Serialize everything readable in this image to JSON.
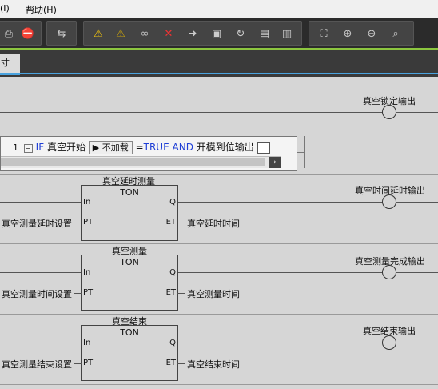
{
  "menubar": {
    "items": [
      "(I)",
      "帮助(H)"
    ]
  },
  "toolbar": {
    "icons": [
      "print-icon",
      "debug-icon",
      "transfer-icon",
      "warning-icon",
      "warning-off-icon",
      "watch-icon",
      "breakpoint-icon",
      "step-icon",
      "step-over-icon",
      "reset-icon",
      "force-on-icon",
      "force-off-icon",
      "fit-icon",
      "zoom-in-icon",
      "zoom-out-icon",
      "zoom-reset-icon"
    ]
  },
  "tab": {
    "label": "寸"
  },
  "rungs": {
    "r1": {
      "coil": "真空锁定输出"
    },
    "r2": {
      "st_line_no": "1",
      "st_if": "IF",
      "st_cond": "真空开始",
      "st_dropdown": "不加载",
      "st_eq": "=",
      "st_true": "TRUE",
      "st_and": "AND",
      "st_rest": "开模到位输出",
      "scroll_arrow": "›"
    },
    "r3": {
      "fb_name": "真空延时测量",
      "fb_type": "TON",
      "pin_in": "In",
      "pin_q": "Q",
      "pin_pt": "PT",
      "pin_et": "ET",
      "pt_var": "真空测量延时设置",
      "et_var": "真空延时时间",
      "coil": "真空时间延时输出"
    },
    "r4": {
      "fb_name": "真空测量",
      "fb_type": "TON",
      "pin_in": "In",
      "pin_q": "Q",
      "pin_pt": "PT",
      "pin_et": "ET",
      "pt_var": "真空测量时间设置",
      "et_var": "真空测量时间",
      "coil": "真空测量完成输出"
    },
    "r5": {
      "fb_name": "真空结束",
      "fb_type": "TON",
      "pin_in": "In",
      "pin_q": "Q",
      "pin_pt": "PT",
      "pin_et": "ET",
      "pt_var": "真空测量结束设置",
      "et_var": "真空结束时间",
      "coil": "真空结束输出"
    }
  }
}
